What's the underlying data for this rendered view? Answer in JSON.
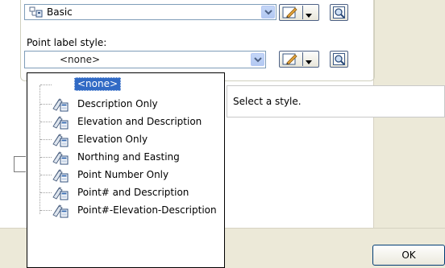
{
  "top_style": {
    "value": "Basic",
    "icon": "style-icon"
  },
  "point_label": {
    "label": "Point label style:",
    "value": "<none>"
  },
  "dropdown": {
    "selected": "<none>",
    "items": [
      "Description Only",
      "Elevation and Description",
      "Elevation Only",
      "Northing and Easting",
      "Point Number Only",
      "Point# and Description",
      "Point#-Elevation-Description"
    ]
  },
  "tooltip": {
    "text": "Select a style."
  },
  "buttons": {
    "ok": "OK"
  },
  "colors": {
    "selection": "#316ac5",
    "dialog_bg": "#ece9d8",
    "border": "#7f9db9"
  }
}
